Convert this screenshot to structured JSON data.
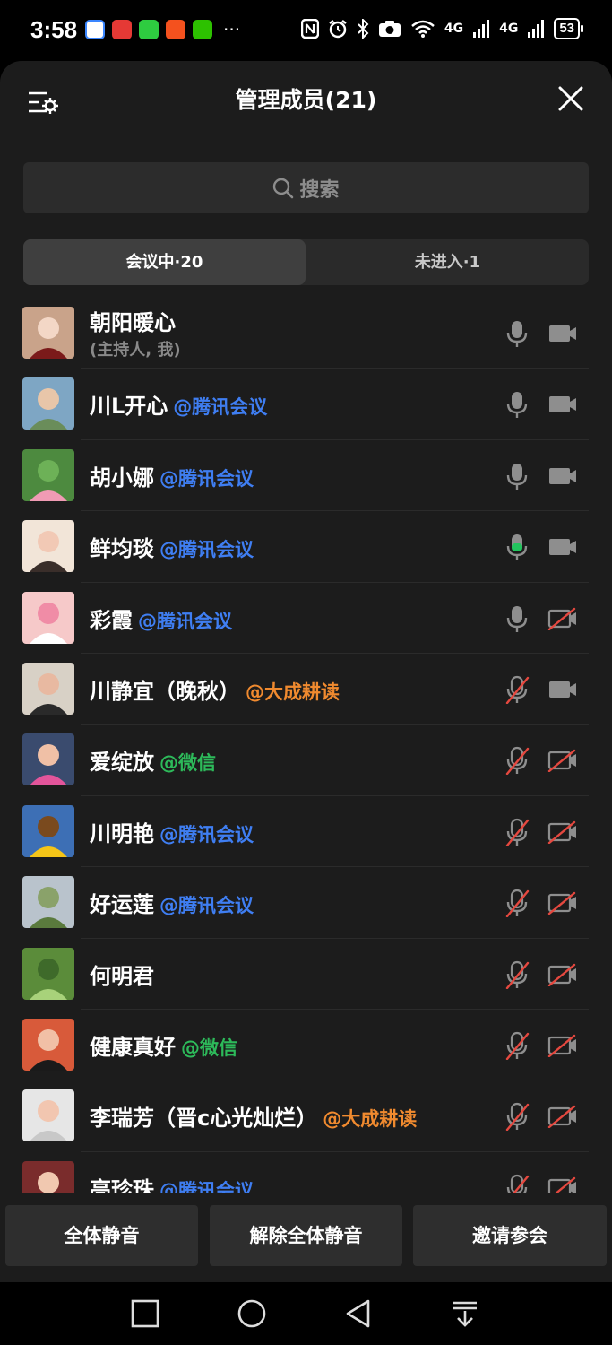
{
  "status": {
    "time": "3:58",
    "battery": "53",
    "signal1": "4G",
    "signal2": "4G"
  },
  "header": {
    "title": "管理成员(21)"
  },
  "search": {
    "placeholder": "搜索"
  },
  "tabs": [
    {
      "label": "会议中·20",
      "active": true
    },
    {
      "label": "未进入·1",
      "active": false
    }
  ],
  "members": [
    {
      "name": "朝阳暖心",
      "role": "(主持人, 我)",
      "tag": "",
      "mic": "on",
      "cam": "on"
    },
    {
      "name": "川L开心",
      "tag": "@腾讯会议",
      "tag_color": "blue",
      "mic": "on",
      "cam": "on"
    },
    {
      "name": "胡小娜",
      "tag": "@腾讯会议",
      "tag_color": "blue",
      "mic": "on",
      "cam": "on"
    },
    {
      "name": "鲜均琰",
      "tag": "@腾讯会议",
      "tag_color": "blue",
      "mic": "speaking",
      "cam": "on"
    },
    {
      "name": "彩霞",
      "tag": "@腾讯会议",
      "tag_color": "blue",
      "mic": "on",
      "cam": "off"
    },
    {
      "name": "川静宜（晚秋）",
      "tag": "@大成耕读",
      "tag_color": "orange",
      "mic": "off",
      "cam": "on"
    },
    {
      "name": "爱绽放",
      "tag": "@微信",
      "tag_color": "green",
      "mic": "off",
      "cam": "off"
    },
    {
      "name": "川明艳",
      "tag": "@腾讯会议",
      "tag_color": "blue",
      "mic": "off",
      "cam": "off"
    },
    {
      "name": "好运莲",
      "tag": "@腾讯会议",
      "tag_color": "blue",
      "mic": "off",
      "cam": "off"
    },
    {
      "name": "何明君",
      "tag": "",
      "mic": "off",
      "cam": "off"
    },
    {
      "name": "健康真好",
      "tag": "@微信",
      "tag_color": "green",
      "mic": "off",
      "cam": "off"
    },
    {
      "name": "李瑞芳（晋c心光灿烂）",
      "tag": "@大成耕读",
      "tag_color": "orange",
      "mic": "off",
      "cam": "off"
    },
    {
      "name": "亮珍珠",
      "tag": "@腾讯会议",
      "tag_color": "blue",
      "mic": "off",
      "cam": "off"
    }
  ],
  "actions": {
    "mute_all": "全体静音",
    "unmute_all": "解除全体静音",
    "invite": "邀请参会"
  },
  "colors": {
    "sheet_bg": "#1c1c1c",
    "tag_blue": "#3f7ef2",
    "tag_orange": "#f08a2f",
    "tag_green": "#2dba5a",
    "muted_red": "#e5483f",
    "speaking_green": "#22c55e"
  }
}
